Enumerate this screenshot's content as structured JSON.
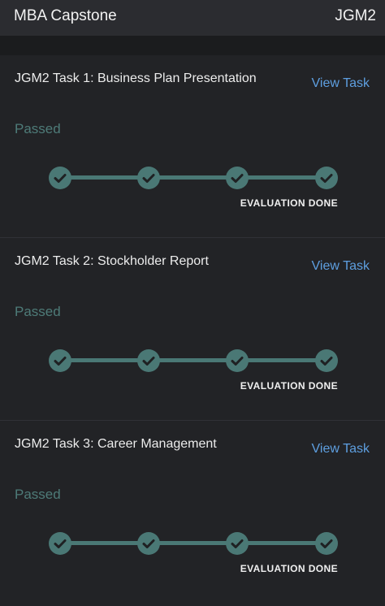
{
  "header": {
    "title": "MBA Capstone",
    "code": "JGM2"
  },
  "tasks": [
    {
      "title": "JGM2 Task 1: Business Plan Presentation",
      "link": "View Task",
      "status": "Passed",
      "steps_completed": 4,
      "steps_total": 4,
      "stage_label": "EVALUATION DONE"
    },
    {
      "title": "JGM2 Task 2: Stockholder Report",
      "link": "View Task",
      "status": "Passed",
      "steps_completed": 4,
      "steps_total": 4,
      "stage_label": "EVALUATION DONE"
    },
    {
      "title": "JGM2 Task 3: Career Management",
      "link": "View Task",
      "status": "Passed",
      "steps_completed": 4,
      "steps_total": 4,
      "stage_label": "EVALUATION DONE"
    }
  ],
  "icons": {
    "step": "checkmark-icon"
  },
  "colors": {
    "accent_teal": "#4a7875",
    "link_blue": "#5e9fe0",
    "background": "#222326"
  }
}
